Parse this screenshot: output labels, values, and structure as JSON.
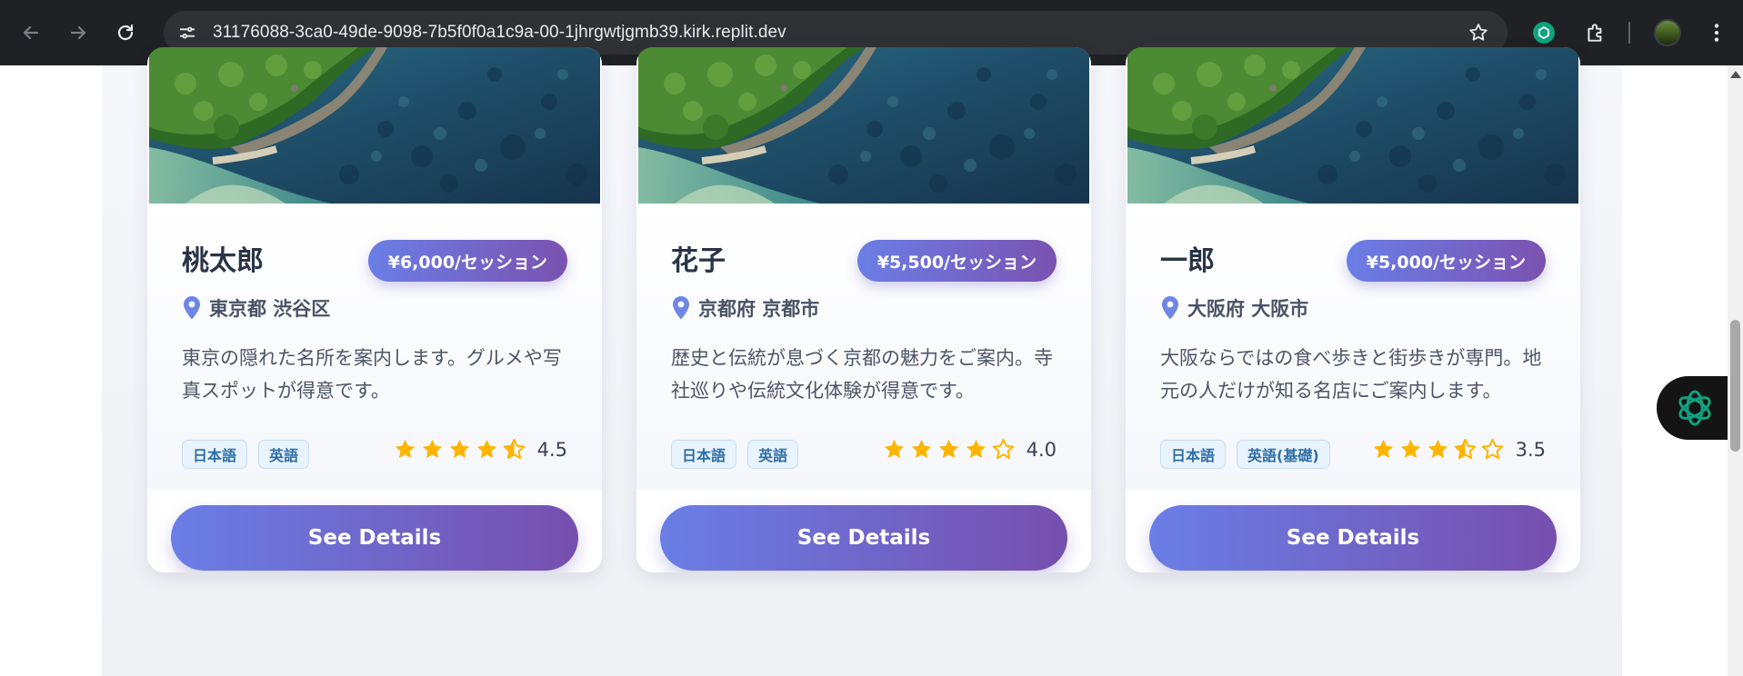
{
  "browser": {
    "url": "31176088-3ca0-49de-9098-7b5f0f0a1c9a-00-1jhrgwtjgmb39.kirk.replit.dev",
    "icons": [
      "back-icon",
      "forward-icon",
      "reload-icon",
      "site-info-icon",
      "bookmark-star-icon",
      "chatgpt-extension-icon",
      "extensions-puzzle-icon",
      "profile-avatar",
      "more-menu-icon"
    ]
  },
  "theme": {
    "accent_gradient_start": "#6a7ee6",
    "accent_gradient_end": "#7b52b0",
    "star_color": "#ffb400",
    "tag_text": "#2f6fa8"
  },
  "guides": [
    {
      "name": "桃太郎",
      "price": "¥6,000/セッション",
      "location": "東京都 渋谷区",
      "description": "東京の隠れた名所を案内します。グルメや写真スポットが得意です。",
      "languages": [
        "日本語",
        "英語"
      ],
      "rating": 4.5,
      "rating_text": "4.5",
      "button": "See Details"
    },
    {
      "name": "花子",
      "price": "¥5,500/セッション",
      "location": "京都府 京都市",
      "description": "歴史と伝統が息づく京都の魅力をご案内。寺社巡りや伝統文化体験が得意です。",
      "languages": [
        "日本語",
        "英語"
      ],
      "rating": 4.0,
      "rating_text": "4.0",
      "button": "See Details"
    },
    {
      "name": "一郎",
      "price": "¥5,000/セッション",
      "location": "大阪府 大阪市",
      "description": "大阪ならではの食べ歩きと街歩きが専門。地元の人だけが知る名店にご案内します。",
      "languages": [
        "日本語",
        "英語(基礎)"
      ],
      "rating": 3.5,
      "rating_text": "3.5",
      "button": "See Details"
    }
  ]
}
